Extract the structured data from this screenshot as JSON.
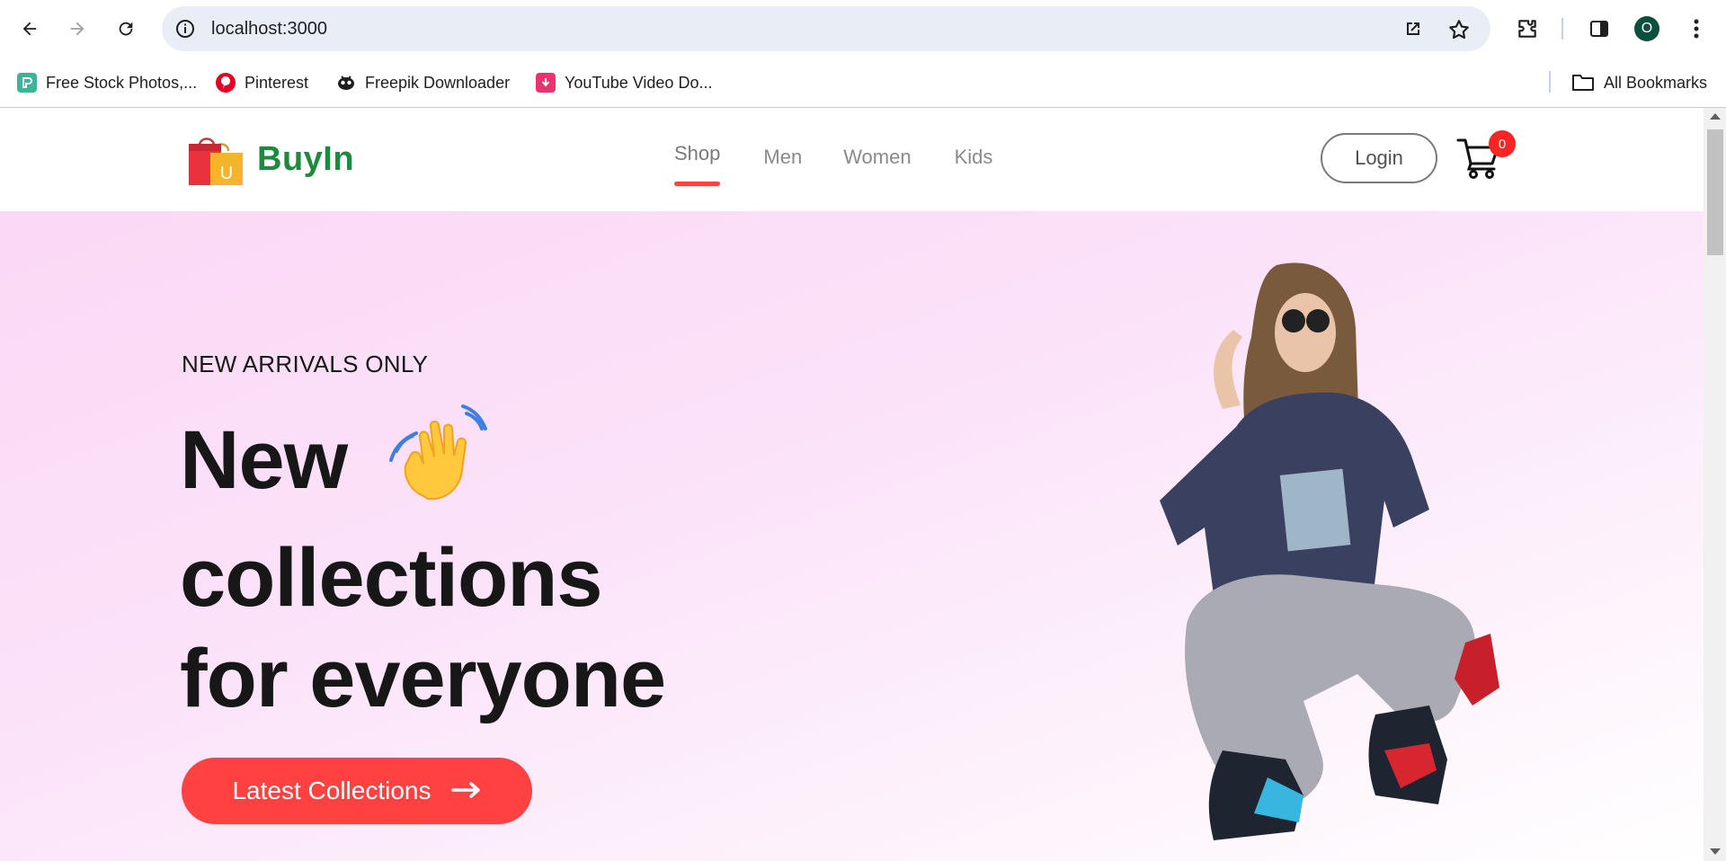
{
  "browser": {
    "url": "localhost:3000",
    "profile_initial": "O",
    "bookmarks": [
      {
        "label": "Free Stock Photos,...",
        "icon": "freepik-stock-icon"
      },
      {
        "label": "Pinterest",
        "icon": "pinterest-icon"
      },
      {
        "label": "Freepik Downloader",
        "icon": "freepik-downloader-icon"
      },
      {
        "label": "YouTube Video Do...",
        "icon": "youtube-downloader-icon"
      }
    ],
    "all_bookmarks": "All Bookmarks"
  },
  "site": {
    "brand": "BuyIn",
    "nav": [
      {
        "label": "Shop",
        "active": true
      },
      {
        "label": "Men",
        "active": false
      },
      {
        "label": "Women",
        "active": false
      },
      {
        "label": "Kids",
        "active": false
      }
    ],
    "login_label": "Login",
    "cart_count": "0"
  },
  "hero": {
    "eyebrow": "NEW ARRIVALS ONLY",
    "headline_line1": "New",
    "headline_line2": "collections",
    "headline_line3": "for everyone",
    "cta_label": "Latest Collections",
    "cta_arrow": "⟶"
  },
  "colors": {
    "accent": "#ff4141",
    "brand": "#1e8a3e",
    "hero_bg": "#fbd8f6"
  }
}
